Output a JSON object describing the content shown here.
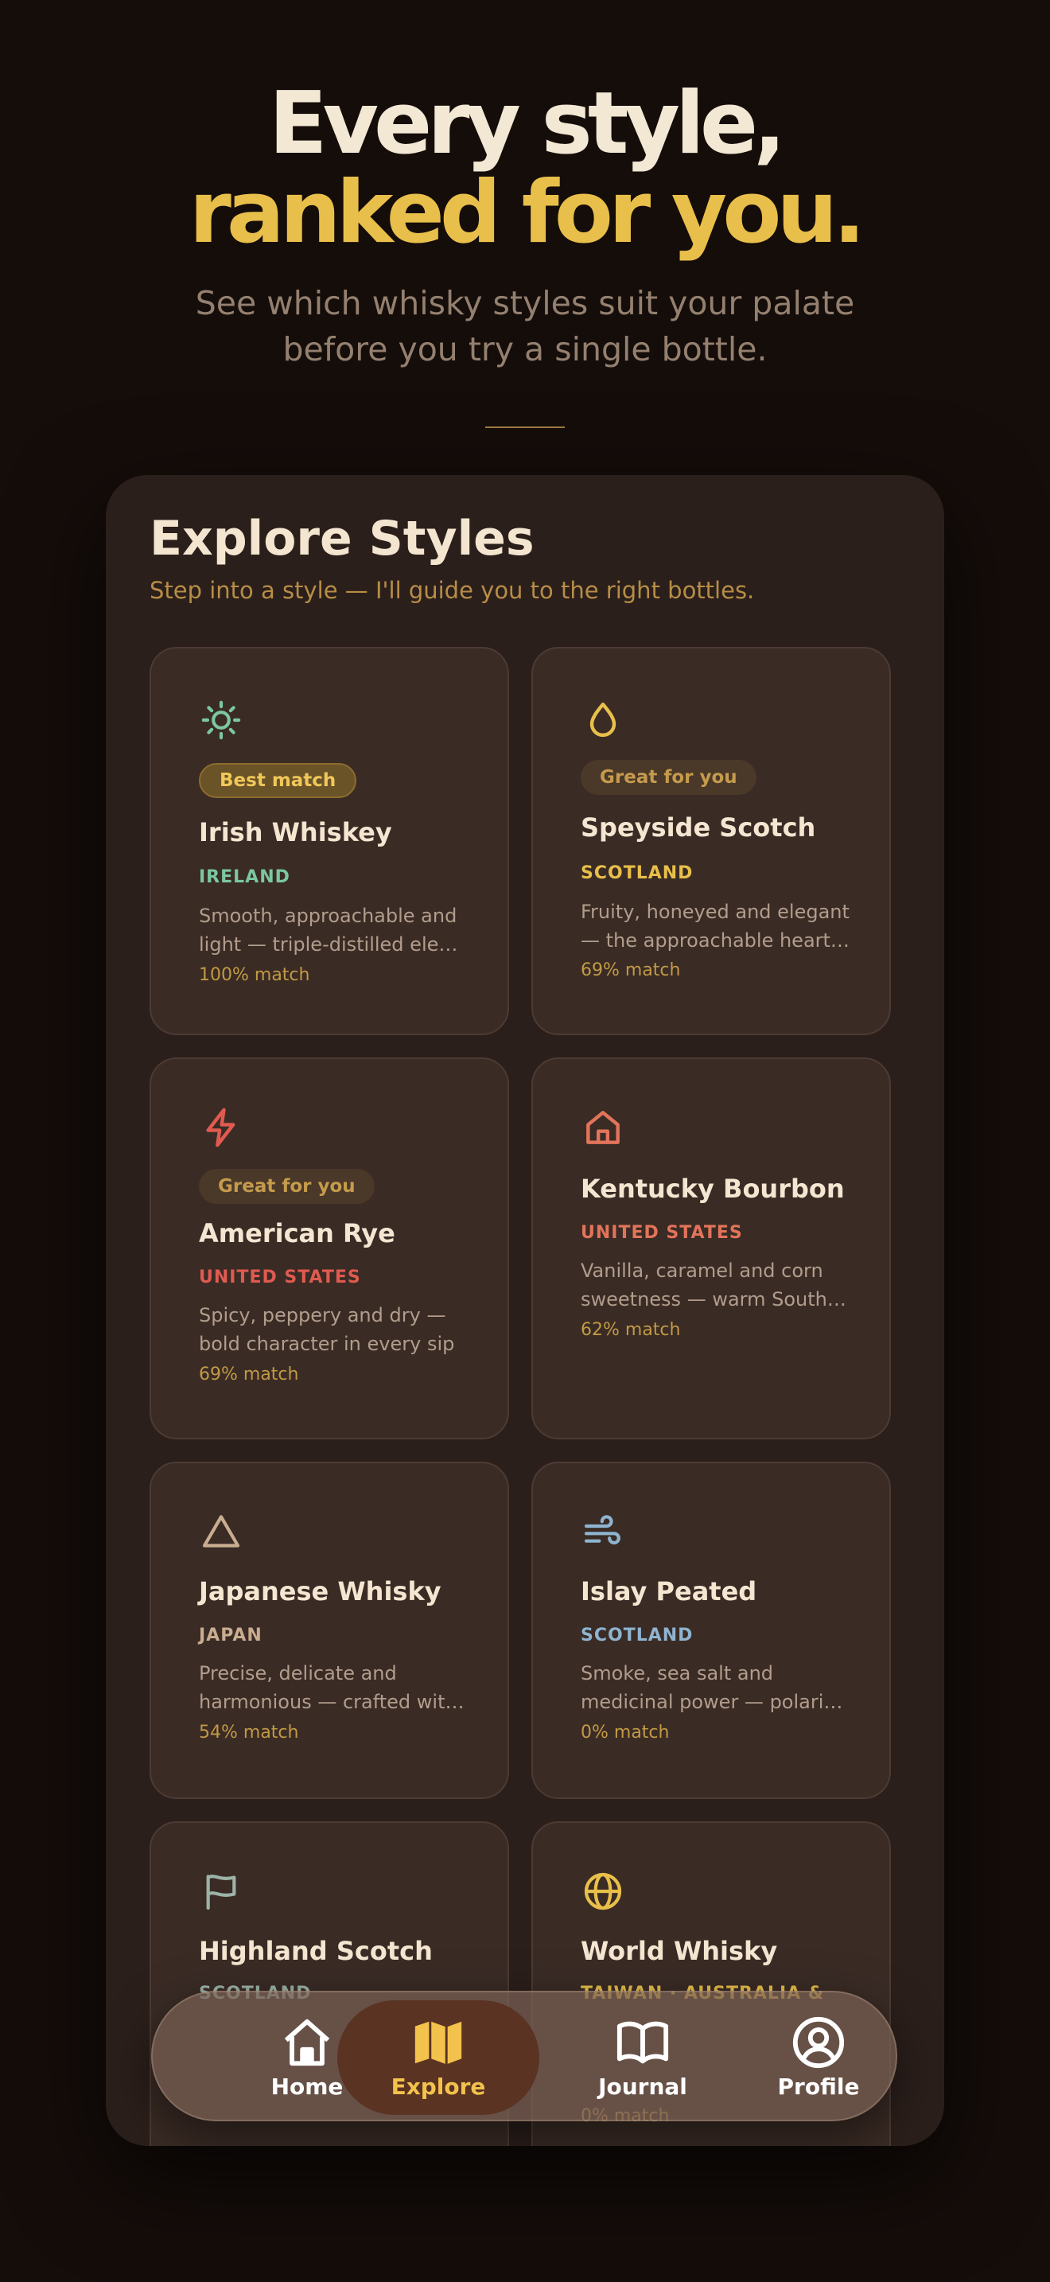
{
  "hero": {
    "line1": "Every style,",
    "line2": "ranked for you.",
    "subtitle_line1": "See which whisky styles suit your palate",
    "subtitle_line2": "before you try a single bottle."
  },
  "screen": {
    "title": "Explore Styles",
    "subtitle": "Step into a style — I'll guide you to the right bottles."
  },
  "cards": [
    {
      "icon": "sun-icon",
      "badge": "Best match",
      "name": "Irish Whiskey",
      "region": "IRELAND",
      "region_color": "#7cc7a0",
      "desc_line1": "Smooth, approachable and",
      "desc_line2": "light — triple-distilled eleg…",
      "match": "100% match"
    },
    {
      "icon": "droplet-icon",
      "badge": "Great for you",
      "name": "Speyside Scotch",
      "region": "SCOTLAND",
      "region_color": "#e8bf4a",
      "desc_line1": "Fruity, honeyed and elegant",
      "desc_line2": "— the approachable heartl…",
      "match": "69% match"
    },
    {
      "icon": "lightning-icon",
      "badge": "Great for you",
      "name": "American Rye",
      "region": "UNITED STATES",
      "region_color": "#e05a50",
      "desc_line1": "Spicy, peppery and dry —",
      "desc_line2": "bold character in every sip",
      "match": "69% match"
    },
    {
      "icon": "house-icon",
      "badge": "",
      "name": "Kentucky Bourbon",
      "region": "UNITED STATES",
      "region_color": "#e2745a",
      "desc_line1": "Vanilla, caramel and corn",
      "desc_line2": "sweetness — warm South…",
      "match": "62% match"
    },
    {
      "icon": "triangle-icon",
      "badge": "",
      "name": "Japanese Whisky",
      "region": "JAPAN",
      "region_color": "#c9ad90",
      "desc_line1": "Precise, delicate and",
      "desc_line2": "harmonious — crafted with…",
      "match": "54% match"
    },
    {
      "icon": "wind-icon",
      "badge": "",
      "name": "Islay Peated",
      "region": "SCOTLAND",
      "region_color": "#8eb4d0",
      "desc_line1": "Smoke, sea salt and",
      "desc_line2": "medicinal power — polarisi…",
      "match": "0% match"
    },
    {
      "icon": "flag-icon",
      "badge": "",
      "name": "Highland Scotch",
      "region": "SCOTLAND",
      "region_color": "#9db3a8",
      "desc_line1": "",
      "desc_line2": "",
      "match": ""
    },
    {
      "icon": "globe-icon",
      "badge": "",
      "name": "World Whisky",
      "region": "TAIWAN · AUSTRALIA &",
      "region_color": "#e8bf4a",
      "desc_line1": "",
      "desc_line2": "",
      "match": "0% match"
    }
  ],
  "tabs": [
    {
      "icon": "home-icon",
      "label": "Home",
      "active": false
    },
    {
      "icon": "map-icon",
      "label": "Explore",
      "active": true
    },
    {
      "icon": "book-icon",
      "label": "Journal",
      "active": false
    },
    {
      "icon": "profile-icon",
      "label": "Profile",
      "active": false
    }
  ],
  "colors": {
    "accent": "#e8bf4a",
    "background": "#150d0a",
    "card": "#3a2b25"
  }
}
